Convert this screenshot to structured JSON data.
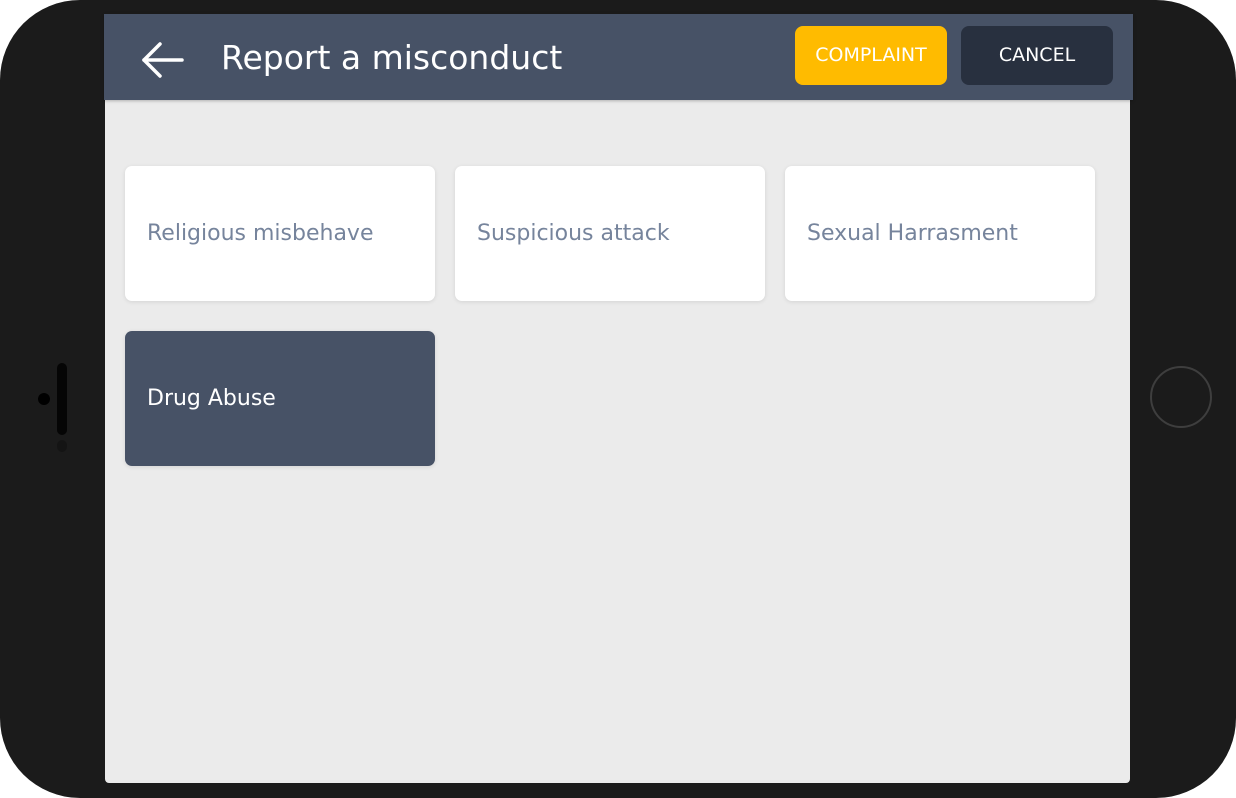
{
  "header": {
    "title": "Report a misconduct",
    "complaint_label": "COMPLAINT",
    "cancel_label": "CANCEL",
    "back_icon": "arrow-left-icon"
  },
  "categories": [
    {
      "label": "Religious misbehave",
      "selected": false
    },
    {
      "label": "Suspicious attack",
      "selected": false
    },
    {
      "label": "Sexual Harrasment",
      "selected": false
    },
    {
      "label": "Drug Abuse",
      "selected": true
    }
  ],
  "colors": {
    "app_bar": "#475266",
    "complaint_accent": "#ffbb00",
    "cancel_bg": "#28303f",
    "screen_bg": "#ebebeb",
    "card_text": "#76849c",
    "device_frame": "#1b1b1b"
  }
}
